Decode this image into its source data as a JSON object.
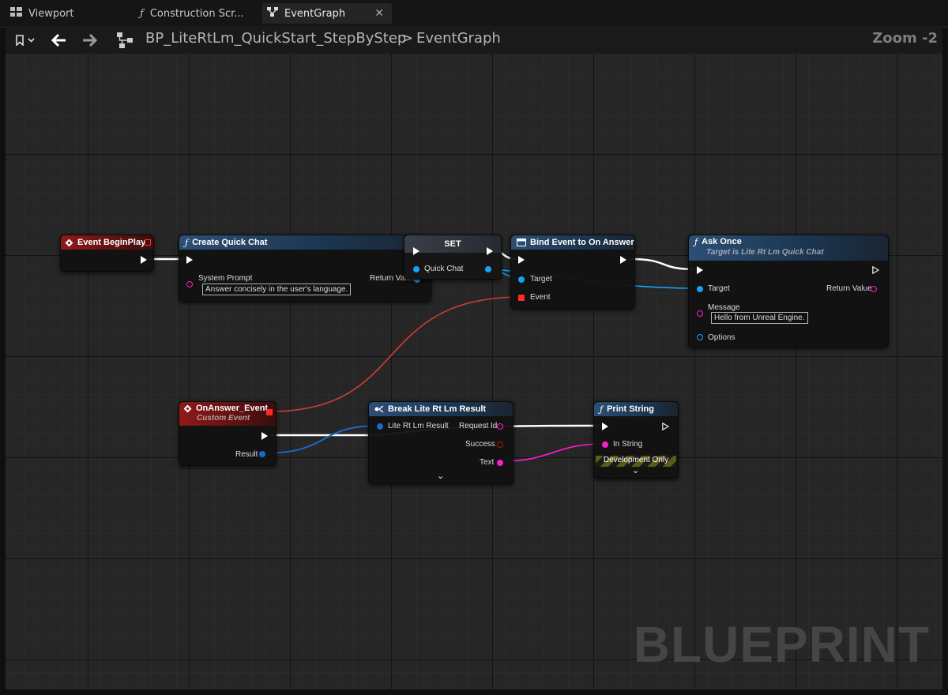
{
  "tabs": [
    {
      "label": "Viewport",
      "icon": "viewport-grid-icon"
    },
    {
      "label": "Construction Scr...",
      "icon": "function-icon"
    },
    {
      "label": "EventGraph",
      "icon": "graph-icon",
      "active": true
    }
  ],
  "toolbar": {
    "breadcrumb_root": "BP_LiteRtLm_QuickStart_StepByStep",
    "breadcrumb_separator": ">",
    "breadcrumb_leaf": "EventGraph",
    "zoom": "Zoom -2"
  },
  "watermark": "BLUEPRINT",
  "nodes": {
    "begin_play": {
      "title": "Event BeginPlay"
    },
    "create_quick_chat": {
      "title": "Create Quick Chat",
      "pin_system_prompt": "System Prompt",
      "system_prompt_value": "Answer concisely in the user's language.",
      "pin_return": "Return Value"
    },
    "set": {
      "title": "SET",
      "pin_quick_chat": "Quick Chat"
    },
    "bind_event": {
      "title": "Bind Event to On Answer",
      "pin_target": "Target",
      "pin_event": "Event"
    },
    "ask_once": {
      "title": "Ask Once",
      "subtitle": "Target is Lite Rt Lm Quick Chat",
      "pin_target": "Target",
      "pin_return": "Return Value",
      "pin_message": "Message",
      "message_value": "Hello from Unreal Engine.",
      "pin_options": "Options"
    },
    "on_answer": {
      "title": "OnAnswer_Event",
      "subtitle": "Custom Event",
      "pin_result": "Result"
    },
    "break_result": {
      "title": "Break Lite Rt Lm Result",
      "pin_in": "Lite Rt Lm Result",
      "pin_request_id": "Request Id",
      "pin_success": "Success",
      "pin_text": "Text"
    },
    "print_string": {
      "title": "Print String",
      "pin_in_string": "In String",
      "dev_only": "Development Only"
    }
  },
  "colors": {
    "exec_wire": "#ffffff",
    "object_wire": "#18a0f3",
    "string_wire": "#ff19d0",
    "delegate_wire": "#d03a3a",
    "event_header": "#8f1a1a",
    "function_header": "#2c4f75"
  }
}
